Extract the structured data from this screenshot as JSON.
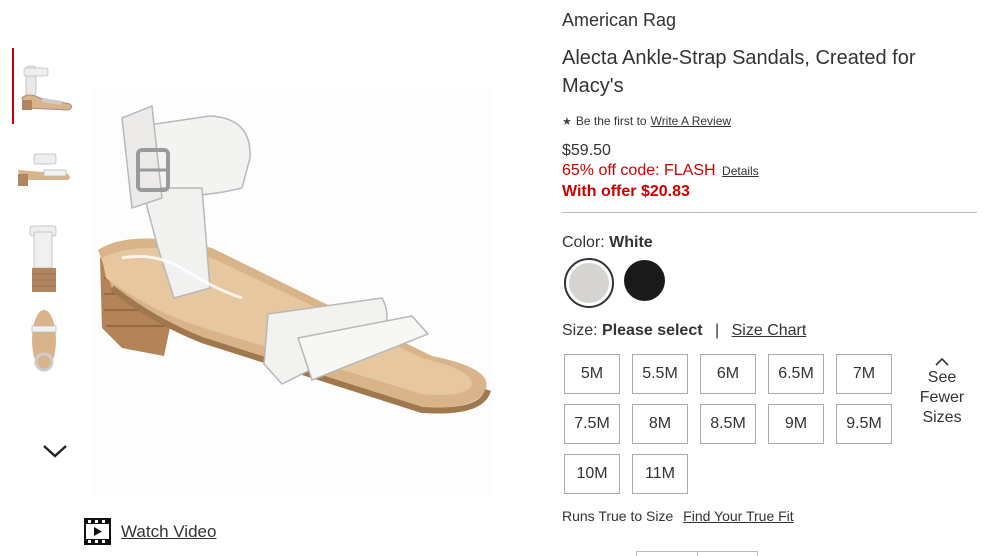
{
  "product": {
    "brand": "American Rag",
    "title": "Alecta Ankle-Strap Sandals, Created for Macy's",
    "review_prefix": "Be the first to",
    "review_link": "Write A Review",
    "price": "$59.50",
    "offer_text": "65% off code: FLASH",
    "offer_details": "Details",
    "with_offer": "With offer $20.83"
  },
  "gallery": {
    "thumbnail_count": 4,
    "active_index": 0,
    "watch_video_label": "Watch Video"
  },
  "color": {
    "label": "Color:",
    "selected": "White",
    "swatches": [
      {
        "name": "White",
        "hex": "#d6d4d0"
      },
      {
        "name": "Black",
        "hex": "#1a1a1a"
      }
    ]
  },
  "size": {
    "label": "Size:",
    "prompt": "Please select",
    "separator": "|",
    "chart_link": "Size Chart",
    "options": [
      "5M",
      "5.5M",
      "6M",
      "6.5M",
      "7M",
      "7.5M",
      "8M",
      "8.5M",
      "9M",
      "9.5M",
      "10M",
      "11M"
    ],
    "toggle_label": "See Fewer Sizes"
  },
  "fit": {
    "text": "Runs True to Size",
    "link": "Find Your True Fit"
  },
  "colors": {
    "accent": "#cc0000",
    "text": "#333333",
    "border": "#aaaaaa"
  }
}
